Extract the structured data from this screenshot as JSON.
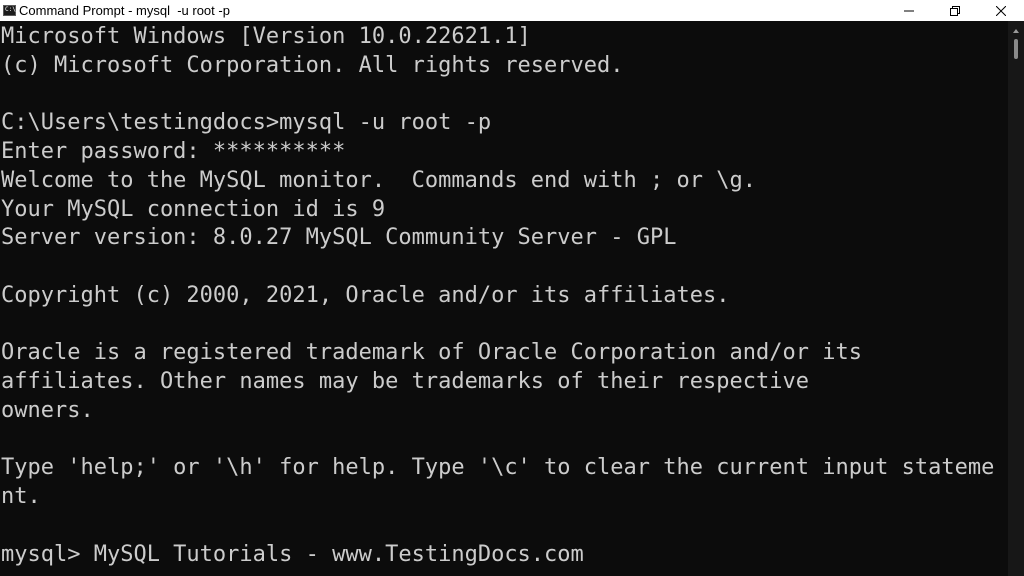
{
  "window": {
    "title": "Command Prompt - mysql  -u root -p",
    "icon_glyph": "C:\\",
    "icon_name": "command-prompt-icon",
    "controls": [
      "minimize-icon",
      "maximize-icon",
      "close-icon"
    ]
  },
  "console": {
    "lines": [
      "Microsoft Windows [Version 10.0.22621.1]",
      "(c) Microsoft Corporation. All rights reserved.",
      "",
      "C:\\Users\\testingdocs>mysql -u root -p",
      "Enter password: **********",
      "Welcome to the MySQL monitor.  Commands end with ; or \\g.",
      "Your MySQL connection id is 9",
      "Server version: 8.0.27 MySQL Community Server - GPL",
      "",
      "Copyright (c) 2000, 2021, Oracle and/or its affiliates.",
      "",
      "Oracle is a registered trademark of Oracle Corporation and/or its",
      "affiliates. Other names may be trademarks of their respective",
      "owners.",
      "",
      "Type 'help;' or '\\h' for help. Type '\\c' to clear the current input stateme",
      "nt.",
      "",
      "mysql> MySQL Tutorials - www.TestingDocs.com"
    ]
  },
  "colors": {
    "console_background": "#0c0c0c",
    "console_text": "#cccccc",
    "titlebar_background": "#ffffff"
  }
}
